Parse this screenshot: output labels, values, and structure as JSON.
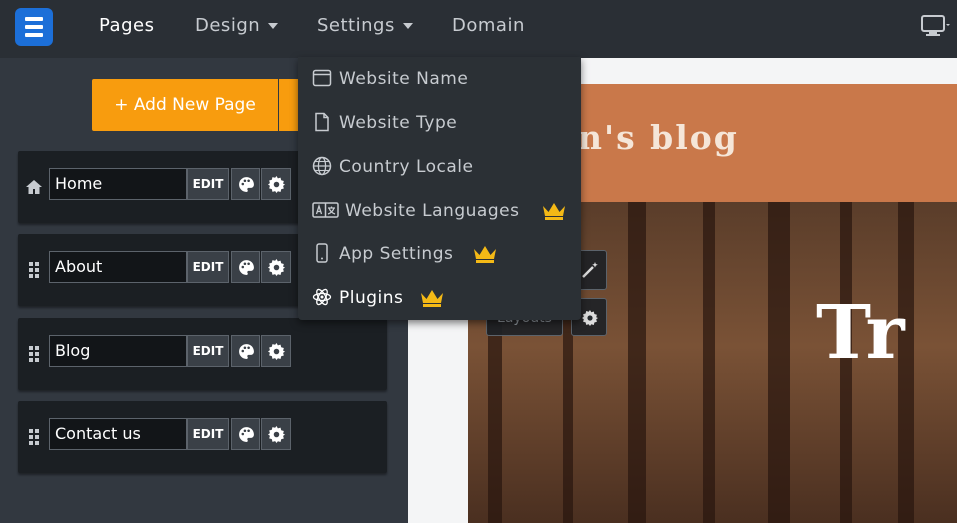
{
  "topbar": {
    "logo_icon": "site-builder-logo-icon",
    "nav": [
      {
        "label": "Pages",
        "active": true
      },
      {
        "label": "Design",
        "has_caret": true
      },
      {
        "label": "Settings",
        "has_caret": true
      },
      {
        "label": "Domain"
      }
    ],
    "device_icon": "desktop-icon"
  },
  "left_panel": {
    "add_button_label": "+ Add New Page",
    "pages": [
      {
        "name": "Home",
        "icon": "home-icon"
      },
      {
        "name": "About",
        "icon": "drag-handle-icon"
      },
      {
        "name": "Blog",
        "icon": "drag-handle-icon"
      },
      {
        "name": "Contact us",
        "icon": "drag-handle-icon"
      }
    ],
    "edit_label": "EDIT"
  },
  "settings_menu": {
    "items": [
      {
        "label": "Website Name",
        "icon": "browser-window-icon",
        "premium": false
      },
      {
        "label": "Website Type",
        "icon": "document-icon",
        "premium": false
      },
      {
        "label": "Country Locale",
        "icon": "globe-icon",
        "premium": false
      },
      {
        "label": "Website Languages",
        "icon": "language-icon",
        "premium": true
      },
      {
        "label": "App Settings",
        "icon": "mobile-icon",
        "premium": true
      },
      {
        "label": "Plugins",
        "icon": "atom-icon",
        "premium": true,
        "active": true
      }
    ],
    "premium_icon": "crown-icon",
    "premium_color": "#f4b916"
  },
  "preview": {
    "blog_title": "n's blog",
    "hero_text": "Tr",
    "layouts_label": "Layouts"
  },
  "colors": {
    "accent": "#f89c0e",
    "brand": "#1c6fd8",
    "header_band": "#c9784a"
  }
}
